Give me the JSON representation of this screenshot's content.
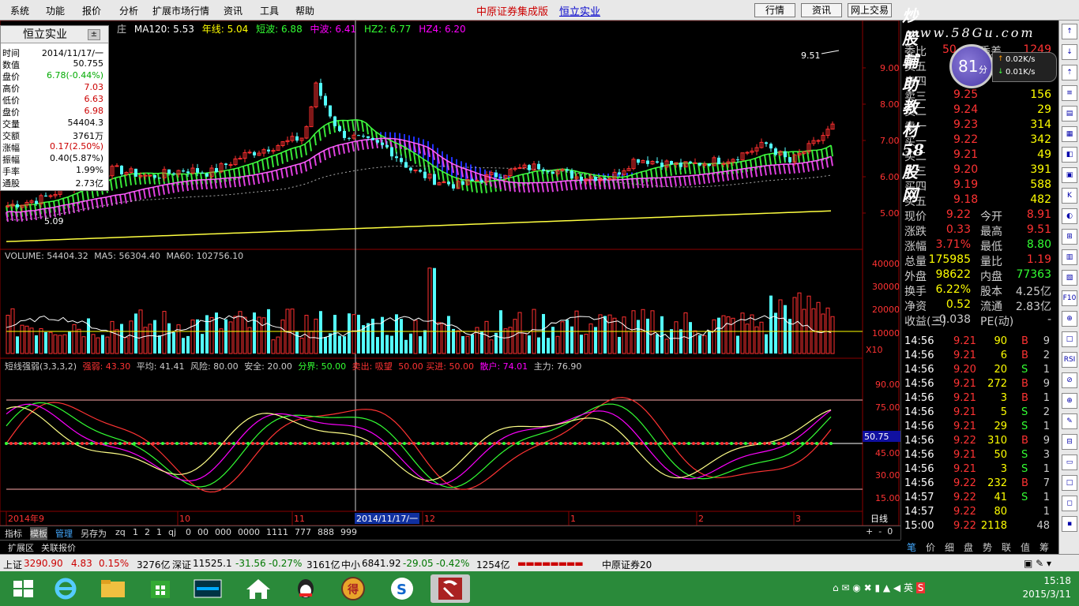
{
  "menu": [
    "系统",
    "功能",
    "报价",
    "分析",
    "扩展市场行情",
    "资讯",
    "工具",
    "帮助"
  ],
  "title": {
    "app": "中原证券集成版",
    "stock": "恒立实业"
  },
  "top_buttons": [
    "行情",
    "资讯",
    "网上交易"
  ],
  "watermark": {
    "line1": "炒股輔助教材58股网",
    "line2": "www.58Gu.com"
  },
  "speed": {
    "score": "81",
    "unit": "分",
    "up": "0.02K/s",
    "down": "0.01K/s"
  },
  "info_panel": {
    "title": "恒立实业",
    "rows": [
      {
        "k": "时间",
        "v": "2014/11/17/一"
      },
      {
        "k": "数值",
        "v": "50.755"
      },
      {
        "k": "盘价",
        "v": "6.78(-0.44%)"
      },
      {
        "k": "高价",
        "v": "7.03"
      },
      {
        "k": "低价",
        "v": "6.63"
      },
      {
        "k": "盘价",
        "v": "6.98"
      },
      {
        "k": "交量",
        "v": "54404.3"
      },
      {
        "k": "交额",
        "v": "3761万"
      },
      {
        "k": "涨幅",
        "v": "0.17(2.50%)"
      },
      {
        "k": "振幅",
        "v": "0.40(5.87%)"
      },
      {
        "k": "手率",
        "v": "1.99%"
      },
      {
        "k": "通股",
        "v": "2.73亿"
      }
    ]
  },
  "ma_header": {
    "prefix": "庄",
    "ma120": "MA120: 5.53",
    "year": "年线: 5.04",
    "short": "短波: 6.88",
    "mid": "中波: 6.41",
    "hz2": "HZ2: 6.77",
    "hz4": "HZ4: 6.20"
  },
  "price_axis": [
    "9.00",
    "8.00",
    "7.00",
    "6.00",
    "5.00"
  ],
  "price_annot": {
    "high": "9.51",
    "low": "5.09"
  },
  "volume_header": {
    "vol": "VOLUME: 54404.32",
    "ma5": "MA5: 56304.40",
    "ma60": "MA60: 102756.10"
  },
  "volume_axis": [
    "40000",
    "30000",
    "20000",
    "10000"
  ],
  "volume_unit": "X10",
  "ind_header": {
    "name": "短线强弱(3,3,3,2)",
    "weak": "强弱: 43.30",
    "avg": "平均: 41.41",
    "risk": "风险: 80.00",
    "safe": "安全: 20.00",
    "div": "分界: 50.00",
    "sell": "卖出: 吸望",
    "buy": "50.00 买进: 50.00",
    "spread": "散户: 74.01",
    "main": "主力: 76.90"
  },
  "ind_axis": [
    "90.00",
    "75.00",
    "45.00",
    "30.00",
    "15.00"
  ],
  "ind_marker": "50.75",
  "date_axis": [
    "2014年9",
    "10",
    "11",
    "12",
    "1",
    "2",
    "3"
  ],
  "date_cursor": "2014/11/17/一",
  "period": "日线",
  "bottom_tools": [
    "指标",
    "模板",
    "管理",
    "另存为",
    "zq",
    "1",
    "2",
    "1",
    "qj",
    "0",
    "00",
    "000",
    "0000",
    "1111",
    "777",
    "888",
    "999"
  ],
  "ext_tabs": [
    "扩展区",
    "关联报价"
  ],
  "quotes": {
    "wb": {
      "k": "委比",
      "v": "50",
      "k2": "委差",
      "v2": "1249"
    },
    "sell": [
      {
        "k": "卖五",
        "p": "",
        "v": ""
      },
      {
        "k": "卖四",
        "p": "",
        "v": ""
      },
      {
        "k": "卖三",
        "p": "9.25",
        "v": "156"
      },
      {
        "k": "卖二",
        "p": "9.24",
        "v": "29"
      },
      {
        "k": "卖一",
        "p": "9.23",
        "v": "314"
      }
    ],
    "buy": [
      {
        "k": "买一",
        "p": "9.22",
        "v": "342"
      },
      {
        "k": "买二",
        "p": "9.21",
        "v": "49"
      },
      {
        "k": "买三",
        "p": "9.20",
        "v": "391"
      },
      {
        "k": "买四",
        "p": "9.19",
        "v": "588"
      },
      {
        "k": "买五",
        "p": "9.18",
        "v": "482"
      }
    ],
    "stats": [
      {
        "k": "现价",
        "v": "9.22",
        "k2": "今开",
        "v2": "8.91"
      },
      {
        "k": "涨跌",
        "v": "0.33",
        "k2": "最高",
        "v2": "9.51"
      },
      {
        "k": "涨幅",
        "v": "3.71%",
        "k2": "最低",
        "v2": "8.80"
      },
      {
        "k": "总量",
        "v": "175985",
        "k2": "量比",
        "v2": "1.19"
      },
      {
        "k": "外盘",
        "v": "98622",
        "k2": "内盘",
        "v2": "77363"
      },
      {
        "k": "换手",
        "v": "6.22%",
        "k2": "股本",
        "v2": "4.25亿"
      },
      {
        "k": "净资",
        "v": "0.52",
        "k2": "流通",
        "v2": "2.83亿"
      },
      {
        "k": "收益(三)",
        "v": "-0.038",
        "k2": "PE(动)",
        "v2": "-"
      }
    ]
  },
  "ticks": [
    {
      "t": "14:56",
      "p": "9.21",
      "v": "90",
      "s": "B",
      "n": "9"
    },
    {
      "t": "14:56",
      "p": "9.21",
      "v": "6",
      "s": "B",
      "n": "2"
    },
    {
      "t": "14:56",
      "p": "9.20",
      "v": "20",
      "s": "S",
      "n": "1"
    },
    {
      "t": "14:56",
      "p": "9.21",
      "v": "272",
      "s": "B",
      "n": "9"
    },
    {
      "t": "14:56",
      "p": "9.21",
      "v": "3",
      "s": "B",
      "n": "1"
    },
    {
      "t": "14:56",
      "p": "9.21",
      "v": "5",
      "s": "S",
      "n": "2"
    },
    {
      "t": "14:56",
      "p": "9.21",
      "v": "29",
      "s": "S",
      "n": "1"
    },
    {
      "t": "14:56",
      "p": "9.22",
      "v": "310",
      "s": "B",
      "n": "9"
    },
    {
      "t": "14:56",
      "p": "9.21",
      "v": "50",
      "s": "S",
      "n": "3"
    },
    {
      "t": "14:56",
      "p": "9.21",
      "v": "3",
      "s": "S",
      "n": "1"
    },
    {
      "t": "14:56",
      "p": "9.22",
      "v": "232",
      "s": "B",
      "n": "7"
    },
    {
      "t": "14:57",
      "p": "9.22",
      "v": "41",
      "s": "S",
      "n": "1"
    },
    {
      "t": "14:57",
      "p": "9.22",
      "v": "80",
      "s": "",
      "n": "1"
    },
    {
      "t": "15:00",
      "p": "9.22",
      "v": "2118",
      "s": "",
      "n": "48"
    }
  ],
  "right_tabs": [
    "笔",
    "价",
    "细",
    "盘",
    "势",
    "联",
    "值",
    "筹"
  ],
  "side_icons": [
    "↑",
    "↓",
    "⇡",
    "≡",
    "▤",
    "▦",
    "◧",
    "▣",
    "K",
    "◐",
    "⊞",
    "▥",
    "▧",
    "F10",
    "⊕",
    "□",
    "RSI",
    "⊘",
    "⊕",
    "✎",
    "⊟",
    "▭",
    "□",
    "◻",
    "▪"
  ],
  "status": {
    "sh_name": "上证",
    "sh_val": "3290.90",
    "sh_chg": "4.83",
    "sh_pct": "0.15%",
    "sh_amt": "3276亿",
    "sz_name": "深证",
    "sz_val": "11525.1",
    "sz_chg": "-31.56",
    "sz_pct": "-0.27%",
    "sz_amt": "3161亿",
    "zx_name": "中小",
    "zx_val": "6841.92",
    "zx_chg": "-29.05",
    "zx_pct": "-0.42%",
    "zx_amt": "1254亿",
    "broker": "中原证券20"
  },
  "clock": {
    "time": "15:18",
    "date": "2015/3/11"
  },
  "colors": {
    "up": "#ff3030",
    "down": "#54ffff",
    "ma_green": "#38e838",
    "ma_magenta": "#e040e0",
    "yellow": "#ffff40",
    "blue": "#2030ff"
  }
}
